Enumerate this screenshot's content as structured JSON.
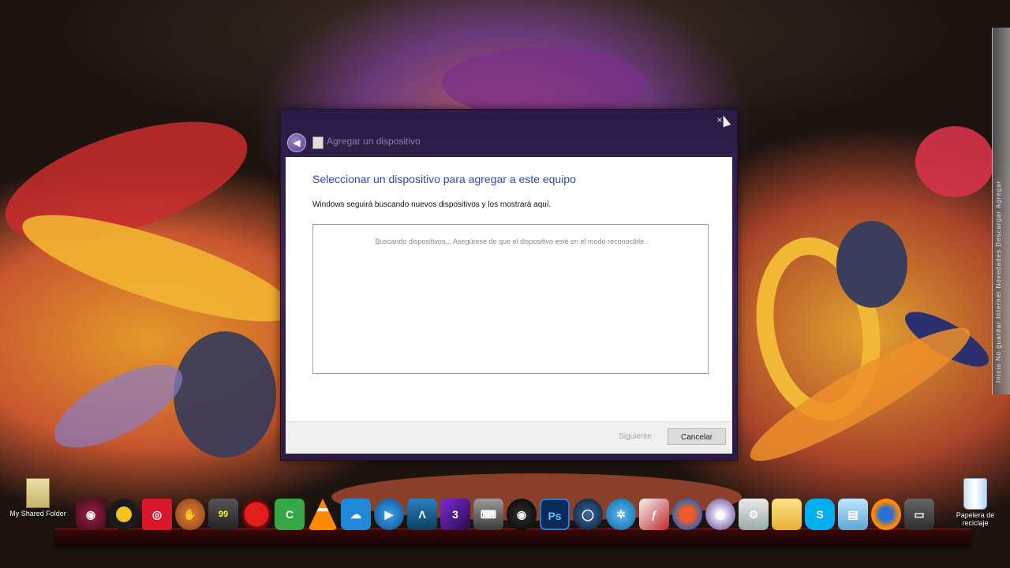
{
  "dialog": {
    "title": "Agregar un dispositivo",
    "heading": "Seleccionar un dispositivo para agregar a este equipo",
    "subtext": "Windows seguirá buscando nuevos dispositivos y los mostrará aquí.",
    "searching_text": "Buscando dispositivos... Asegúrese de que el dispositivo esté en el modo reconocible.",
    "next_label": "Siguiente",
    "cancel_label": "Cancelar",
    "close_glyph": "×",
    "back_glyph": "◀"
  },
  "desktop": {
    "shared_folder_label": "My Shared Folder",
    "recycle_bin_label": "Papelera de reciclaje"
  },
  "side_gadget_text": "Inicio   No guardar   Internet   Novedades   Descargar   Agregar",
  "dock": {
    "items": [
      {
        "icon": "media-player-icon",
        "glyph": "◉"
      },
      {
        "icon": "eye-app-icon",
        "glyph": ""
      },
      {
        "icon": "target-app-icon",
        "glyph": "◎"
      },
      {
        "icon": "glove-app-icon",
        "glyph": "✋"
      },
      {
        "icon": "counter-app-icon",
        "glyph": "99"
      },
      {
        "icon": "record-button-icon",
        "glyph": ""
      },
      {
        "icon": "camtasia-icon",
        "glyph": "C"
      },
      {
        "icon": "vlc-icon",
        "glyph": ""
      },
      {
        "icon": "cloud-app-icon",
        "glyph": "☁"
      },
      {
        "icon": "play-app-icon",
        "glyph": "▶"
      },
      {
        "icon": "arch-app-icon",
        "glyph": "Λ"
      },
      {
        "icon": "game-3-icon",
        "glyph": "3"
      },
      {
        "icon": "keyboard-app-icon",
        "glyph": "⌨"
      },
      {
        "icon": "webcam-icon",
        "glyph": "◉"
      },
      {
        "icon": "photoshop-icon",
        "glyph": "Ps"
      },
      {
        "icon": "cinema4d-icon",
        "glyph": "◯"
      },
      {
        "icon": "reel-app-icon",
        "glyph": "✲"
      },
      {
        "icon": "flash-app-icon",
        "glyph": "ƒ"
      },
      {
        "icon": "beach-ball-icon",
        "glyph": ""
      },
      {
        "icon": "dvd-icon",
        "glyph": "◎"
      },
      {
        "icon": "system-tools-icon",
        "glyph": "⚙"
      },
      {
        "icon": "folder-icon",
        "glyph": ""
      },
      {
        "icon": "skype-icon",
        "glyph": "S"
      },
      {
        "icon": "files-icon",
        "glyph": "▤"
      },
      {
        "icon": "firefox-icon",
        "glyph": ""
      },
      {
        "icon": "monitor-icon",
        "glyph": "▭"
      }
    ]
  }
}
